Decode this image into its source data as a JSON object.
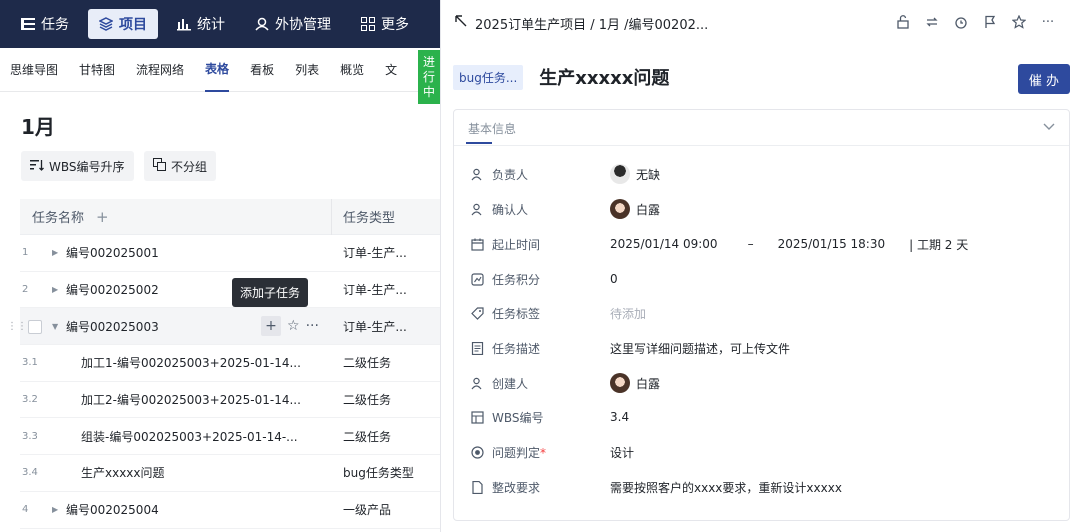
{
  "topnav": {
    "items": [
      {
        "label": "任务",
        "icon": "list-icon",
        "active": false
      },
      {
        "label": "项目",
        "icon": "layers-icon",
        "active": true
      },
      {
        "label": "统计",
        "icon": "bar-chart-icon",
        "active": false
      },
      {
        "label": "外协管理",
        "icon": "handshake-icon",
        "active": false
      },
      {
        "label": "更多",
        "icon": "grid-icon",
        "active": false
      }
    ]
  },
  "view_tabs": [
    "思维导图",
    "甘特图",
    "流程网络",
    "表格",
    "看板",
    "列表",
    "概览",
    "文"
  ],
  "active_view": "表格",
  "status_flag": [
    "进",
    "行",
    "中"
  ],
  "month_title": "1月",
  "toolbar": {
    "sort_label": "WBS编号升序",
    "group_label": "不分组"
  },
  "table": {
    "col_name": "任务名称",
    "col_type": "任务类型",
    "rows": [
      {
        "num": "1",
        "name": "编号002025001",
        "type": "订单-生产...",
        "level": 0,
        "caret": "right"
      },
      {
        "num": "2",
        "name": "编号002025002",
        "type": "订单-生产...",
        "level": 0,
        "caret": "right"
      },
      {
        "num": "",
        "name": "编号002025003",
        "type": "订单-生产...",
        "level": 0,
        "caret": "down"
      },
      {
        "num": "3.1",
        "name": "加工1-编号002025003+2025-01-14...",
        "type": "二级任务",
        "level": 1,
        "caret": ""
      },
      {
        "num": "3.2",
        "name": "加工2-编号002025003+2025-01-14...",
        "type": "二级任务",
        "level": 1,
        "caret": ""
      },
      {
        "num": "3.3",
        "name": "组装-编号002025003+2025-01-14-...",
        "type": "二级任务",
        "level": 1,
        "caret": ""
      },
      {
        "num": "3.4",
        "name": "生产xxxxx问题",
        "type": "bug任务类型",
        "level": 1,
        "caret": ""
      },
      {
        "num": "4",
        "name": "编号002025004",
        "type": "一级产品",
        "level": 0,
        "caret": "right"
      }
    ]
  },
  "tooltip": "添加子任务",
  "detail": {
    "breadcrumb": "2025订单生产项目 / 1月 /编号00202...",
    "type_badge": "bug任务...",
    "title": "生产xxxxx问题",
    "urge_label": "催 办",
    "section_tab": "基本信息",
    "fields": {
      "owner": {
        "label": "负责人",
        "value": "无缺"
      },
      "confirmer": {
        "label": "确认人",
        "value": "白露"
      },
      "period": {
        "label": "起止时间",
        "start": "2025/01/14 09:00",
        "dash": "–",
        "end": "2025/01/15 18:30",
        "duration": "|  工期 2 天"
      },
      "score": {
        "label": "任务积分",
        "value": "0"
      },
      "tags": {
        "label": "任务标签",
        "value": "待添加"
      },
      "desc": {
        "label": "任务描述",
        "value": "这里写详细问题描述，可上传文件"
      },
      "creator": {
        "label": "创建人",
        "value": "白露"
      },
      "wbs": {
        "label": "WBS编号",
        "value": "3.4"
      },
      "judge": {
        "label": "问题判定",
        "required": "*",
        "value": "设计"
      },
      "rectify": {
        "label": "整改要求",
        "value": "需要按照客户的xxxx要求，重新设计xxxxx"
      }
    }
  },
  "colors": {
    "nav_bg": "#1e2a4a",
    "accent": "#2e4a9e",
    "status_green": "#2bb24c"
  }
}
